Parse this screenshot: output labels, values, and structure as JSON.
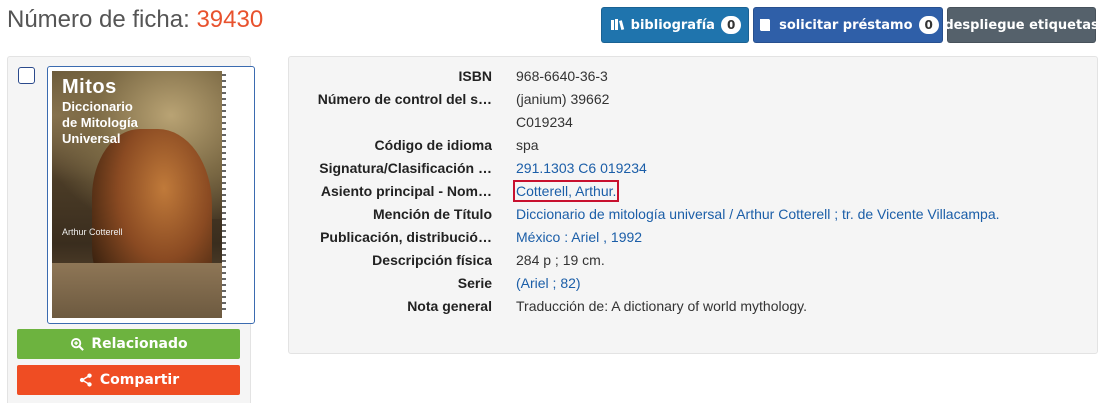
{
  "header": {
    "label": "Número de ficha:",
    "number": "39430"
  },
  "toolbar": {
    "bibliografia": {
      "label": "bibliografía",
      "count": "0",
      "icon": "books-icon"
    },
    "solicitar": {
      "label": "solicitar préstamo",
      "count": "0",
      "icon": "book-icon"
    },
    "despliegue": {
      "label": "despliegue etiquetas"
    }
  },
  "cover": {
    "title": "Mitos",
    "subtitle": [
      "Diccionario",
      "de Mitología",
      "Universal"
    ],
    "author": "Arthur Cotterell"
  },
  "actions": {
    "relacionado": {
      "label": "Relacionado",
      "icon": "zoom-in-icon"
    },
    "compartir": {
      "label": "Compartir",
      "icon": "share-icon"
    }
  },
  "fields": [
    {
      "label": "ISBN",
      "value": "968-6640-36-3",
      "link": false
    },
    {
      "label": "Número de control del s…",
      "value": "(janium) 39662",
      "link": false
    },
    {
      "label": "",
      "value": "C019234",
      "link": false
    },
    {
      "label": "Código de idioma",
      "value": "spa",
      "link": false
    },
    {
      "label": "Signatura/Clasificación …",
      "value": "291.1303 C6 019234",
      "link": true
    },
    {
      "label": "Asiento principal - Nom…",
      "value": "Cotterell, Arthur.",
      "link": true,
      "highlighted": true
    },
    {
      "label": "Mención de Título",
      "value": "Diccionario de mitología universal / Arthur Cotterell ; tr. de Vicente Villacampa.",
      "link": true
    },
    {
      "label": "Publicación, distribució…",
      "value": "México : Ariel , 1992",
      "link": true
    },
    {
      "label": "Descripción física",
      "value": "284 p ; 19 cm.",
      "link": false
    },
    {
      "label": "Serie",
      "value": "(Ariel ; 82)",
      "link": true
    },
    {
      "label": "Nota general",
      "value": "Traducción de: A dictionary of world mythology.",
      "link": false
    }
  ],
  "colors": {
    "accent": "#e8522e",
    "link": "#1b5ea8",
    "highlight": "#c8102e"
  }
}
